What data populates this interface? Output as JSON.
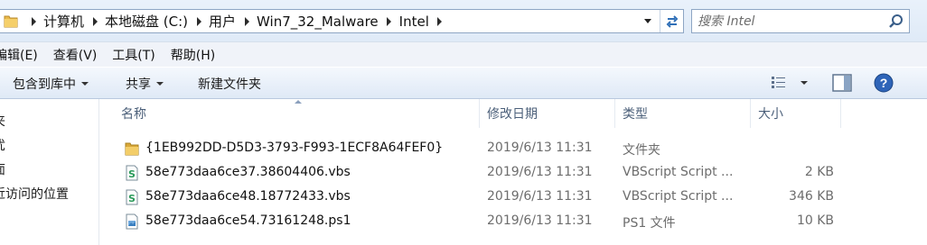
{
  "address_bar": {
    "breadcrumbs": [
      "计算机",
      "本地磁盘 (C:)",
      "用户",
      "Win7_32_Malware",
      "Intel"
    ]
  },
  "search": {
    "placeholder": "搜索 Intel"
  },
  "menu": [
    "编辑(E)",
    "查看(V)",
    "工具(T)",
    "帮助(H)"
  ],
  "toolbar": {
    "include_library": "包含到库中",
    "share": "共享",
    "new_folder": "新建文件夹"
  },
  "nav_pane": {
    "items": [
      "夹",
      "忧",
      "面",
      "近访问的位置"
    ]
  },
  "columns": {
    "name": "名称",
    "date": "修改日期",
    "type": "类型",
    "size": "大小"
  },
  "files": [
    {
      "name": "{1EB992DD-D5D3-3793-F993-1ECF8A64FEF0}",
      "date": "2019/6/13 11:31",
      "type": "文件夹",
      "size": "",
      "icon": "folder-icon"
    },
    {
      "name": "58e773daa6ce37.38604406.vbs",
      "date": "2019/6/13 11:31",
      "type": "VBScript Script ...",
      "size": "2 KB",
      "icon": "vbs-file-icon"
    },
    {
      "name": "58e773daa6ce48.18772433.vbs",
      "date": "2019/6/13 11:31",
      "type": "VBScript Script ...",
      "size": "346 KB",
      "icon": "vbs-file-icon"
    },
    {
      "name": "58e773daa6ce54.73161248.ps1",
      "date": "2019/6/13 11:31",
      "type": "PS1 文件",
      "size": "10 KB",
      "icon": "ps1-file-icon"
    }
  ]
}
